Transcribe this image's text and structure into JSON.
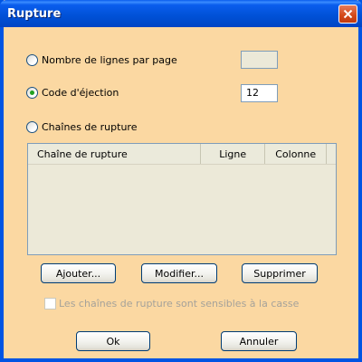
{
  "window": {
    "title": "Rupture",
    "close_icon": "close-icon"
  },
  "options": {
    "lines_per_page_label": "Nombre de lignes par page",
    "lines_per_page_value": "",
    "lines_per_page_selected": false,
    "eject_code_label": "Code d'éjection",
    "eject_code_value": "12",
    "eject_code_selected": true,
    "break_strings_label": "Chaînes de rupture",
    "break_strings_selected": false
  },
  "table": {
    "columns": [
      "Chaîne de rupture",
      "Ligne",
      "Colonne"
    ],
    "rows": []
  },
  "actions": {
    "add_label": "Ajouter...",
    "edit_label": "Modifier...",
    "delete_label": "Supprimer"
  },
  "case_sensitive": {
    "label": "Les chaînes de rupture sont sensibles à la casse",
    "checked": false,
    "enabled": false
  },
  "footer": {
    "ok_label": "Ok",
    "cancel_label": "Annuler"
  }
}
